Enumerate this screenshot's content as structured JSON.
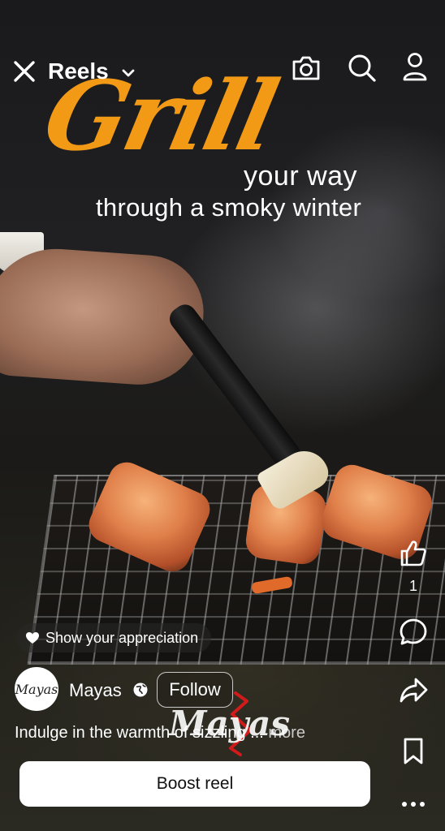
{
  "top_bar": {
    "title": "Reels",
    "close_icon": "close-icon",
    "chevron_icon": "chevron-down-icon",
    "actions": [
      "camera-icon",
      "search-icon",
      "profile-icon"
    ]
  },
  "headline": {
    "script_word": "Grill",
    "line2": "your way",
    "line3": "through a smoky winter"
  },
  "actions": {
    "like_count": "1"
  },
  "appreciation": {
    "label": "Show your appreciation"
  },
  "post": {
    "account_name": "Mayas",
    "avatar_text": "Mayas",
    "follow_label": "Follow",
    "watermark_text": "Mayas",
    "caption": "Indulge in the warmth of sizzling ...",
    "caption_more": "more"
  },
  "boost": {
    "label": "Boost reel"
  },
  "colors": {
    "headline_orange": "#f29a16",
    "boost_bg": "#ffffff",
    "text": "#ffffff"
  }
}
